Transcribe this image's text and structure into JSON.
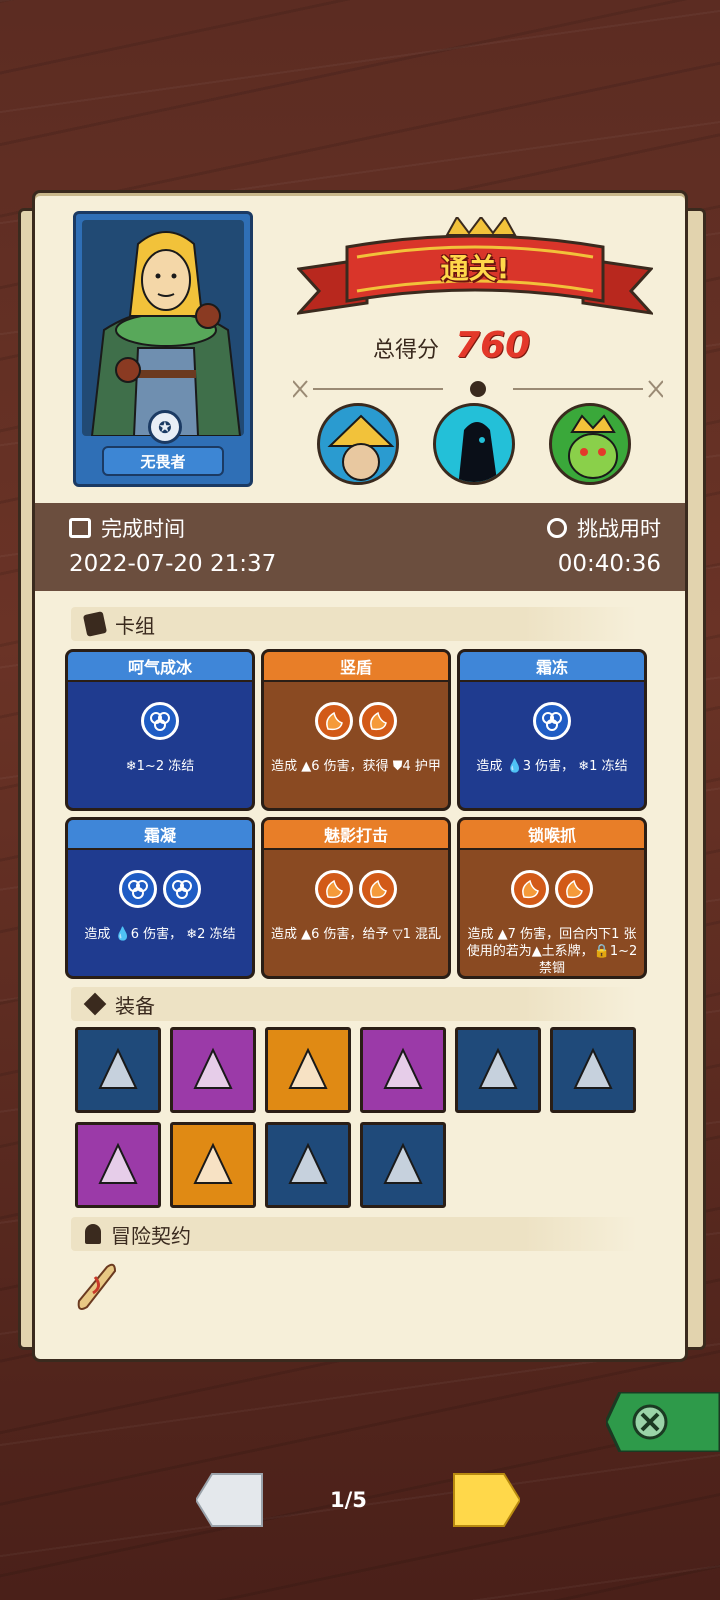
{
  "hero": {
    "name": "无畏者"
  },
  "result": {
    "banner": "通关!",
    "score_label": "总得分",
    "score_value": "760"
  },
  "bosses": [
    "bandit-boss-icon",
    "shadow-boss-icon",
    "goblin-king-icon"
  ],
  "time": {
    "finish_label": "完成时间",
    "finish_value": "2022-07-20 21:37",
    "duration_label": "挑战用时",
    "duration_value": "00:40:36"
  },
  "deck": {
    "title": "卡组",
    "cards": [
      {
        "name": "呵气成冰",
        "color": "blue",
        "cost": 1,
        "desc": "❄1~2 冻结"
      },
      {
        "name": "竖盾",
        "color": "orange",
        "cost": 2,
        "desc": "造成 ▲6 伤害，获得 ⛊4 护甲"
      },
      {
        "name": "霜冻",
        "color": "blue",
        "cost": 1,
        "desc": "造成 💧3 伤害， ❄1 冻结"
      },
      {
        "name": "霜凝",
        "color": "blue",
        "cost": 2,
        "desc": "造成 💧6 伤害， ❄2 冻结"
      },
      {
        "name": "魅影打击",
        "color": "orange",
        "cost": 2,
        "desc": "造成 ▲6 伤害，给予 ▽1 混乱"
      },
      {
        "name": "锁喉抓",
        "color": "orange",
        "cost": 2,
        "desc": "造成 ▲7 伤害，回合内下1 张使用的若为▲土系牌，🔒1~2 禁锢"
      }
    ]
  },
  "equipment": {
    "title": "装备",
    "items": [
      {
        "icon": "axe-icon",
        "bg": "#1f4a7a"
      },
      {
        "icon": "shadow-mask-icon",
        "bg": "#9b3aa8"
      },
      {
        "icon": "serrated-blade-icon",
        "bg": "#e08a14"
      },
      {
        "icon": "crystal-dagger-icon",
        "bg": "#9b3aa8"
      },
      {
        "icon": "round-shield-icon",
        "bg": "#1f4a7a"
      },
      {
        "icon": "horned-skull-icon",
        "bg": "#1f4a7a"
      },
      {
        "icon": "spiked-bracer-icon",
        "bg": "#9b3aa8"
      },
      {
        "icon": "tribal-mask-icon",
        "bg": "#e08a14"
      },
      {
        "icon": "wooden-handle-icon",
        "bg": "#1f4a7a"
      },
      {
        "icon": "chest-armor-icon",
        "bg": "#1f4a7a"
      }
    ]
  },
  "contract": {
    "title": "冒险契约",
    "icon": "scroll-icon"
  },
  "pager": {
    "text": "1/5"
  },
  "colors": {
    "banner_red": "#d9352a",
    "score_red": "#e3382a",
    "band_brown": "#6b4e3e"
  }
}
